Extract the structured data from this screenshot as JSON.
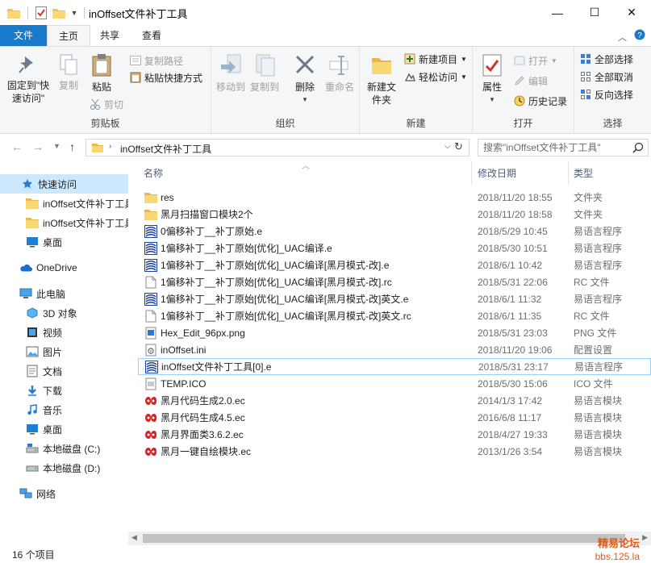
{
  "window": {
    "title": "inOffset文件补丁工具",
    "minimize_glyph": "—",
    "maximize_glyph": "☐",
    "close_glyph": "✕"
  },
  "tabs": {
    "file": "文件",
    "home": "主页",
    "share": "共享",
    "view": "查看"
  },
  "ribbon": {
    "clipboard": {
      "group_label": "剪贴板",
      "pin": "固定到\"快速访问\"",
      "copy": "复制",
      "paste": "粘贴",
      "copy_path": "复制路径",
      "paste_shortcut": "粘贴快捷方式",
      "cut": "剪切"
    },
    "organize": {
      "group_label": "组织",
      "move_to": "移动到",
      "copy_to": "复制到",
      "delete": "删除",
      "rename": "重命名"
    },
    "new": {
      "group_label": "新建",
      "new_folder": "新建文件夹",
      "new_item": "新建项目",
      "easy_access": "轻松访问"
    },
    "open": {
      "group_label": "打开",
      "properties": "属性",
      "open": "打开",
      "edit": "编辑",
      "history": "历史记录"
    },
    "select": {
      "group_label": "选择",
      "select_all": "全部选择",
      "select_none": "全部取消",
      "invert": "反向选择"
    }
  },
  "address": {
    "path": "inOffset文件补丁工具",
    "search_placeholder": "搜索\"inOffset文件补丁工具\""
  },
  "navpane": {
    "quick_access": "快速访问",
    "pinned": [
      "inOffset文件补丁工具",
      "inOffset文件补丁工具"
    ],
    "desktop_pinned": "桌面",
    "onedrive": "OneDrive",
    "this_pc": "此电脑",
    "pc_items": [
      "3D 对象",
      "视频",
      "图片",
      "文档",
      "下载",
      "音乐",
      "桌面",
      "本地磁盘 (C:)",
      "本地磁盘 (D:)"
    ],
    "network": "网络"
  },
  "filelist": {
    "columns": {
      "name": "名称",
      "date": "修改日期",
      "type": "类型"
    },
    "files": [
      {
        "icon": "folder-icon",
        "name": "res",
        "date": "2018/11/20 18:55",
        "type": "文件夹"
      },
      {
        "icon": "folder-icon",
        "name": "黑月扫描窗口模块2个",
        "date": "2018/11/20 18:58",
        "type": "文件夹"
      },
      {
        "icon": "e-file-icon",
        "name": "0偏移补丁__补丁原始.e",
        "date": "2018/5/29 10:45",
        "type": "易语言程序"
      },
      {
        "icon": "e-file-icon",
        "name": "1偏移补丁__补丁原始[优化]_UAC编译.e",
        "date": "2018/5/30 10:51",
        "type": "易语言程序"
      },
      {
        "icon": "e-file-icon",
        "name": "1偏移补丁__补丁原始[优化]_UAC编译[黑月模式-改].e",
        "date": "2018/6/1 10:42",
        "type": "易语言程序"
      },
      {
        "icon": "rc-file-icon",
        "name": "1偏移补丁__补丁原始[优化]_UAC编译[黑月模式-改].rc",
        "date": "2018/5/31 22:06",
        "type": "RC 文件"
      },
      {
        "icon": "e-file-icon",
        "name": "1偏移补丁__补丁原始[优化]_UAC编译[黑月模式-改]英文.e",
        "date": "2018/6/1 11:32",
        "type": "易语言程序"
      },
      {
        "icon": "rc-file-icon",
        "name": "1偏移补丁__补丁原始[优化]_UAC编译[黑月模式-改]英文.rc",
        "date": "2018/6/1 11:35",
        "type": "RC 文件"
      },
      {
        "icon": "png-file-icon",
        "name": "Hex_Edit_96px.png",
        "date": "2018/5/31 23:03",
        "type": "PNG 文件"
      },
      {
        "icon": "ini-file-icon",
        "name": "inOffset.ini",
        "date": "2018/11/20 19:06",
        "type": "配置设置"
      },
      {
        "icon": "e-file-icon",
        "name": "inOffset文件补丁工具[0].e",
        "date": "2018/5/31 23:17",
        "type": "易语言程序"
      },
      {
        "icon": "ico-file-icon",
        "name": "TEMP.ICO",
        "date": "2018/5/30 15:06",
        "type": "ICO 文件"
      },
      {
        "icon": "ec-module-icon",
        "name": "黑月代码生成2.0.ec",
        "date": "2014/1/3 17:42",
        "type": "易语言模块"
      },
      {
        "icon": "ec-module-icon",
        "name": "黑月代码生成4.5.ec",
        "date": "2016/6/8 11:17",
        "type": "易语言模块"
      },
      {
        "icon": "ec-module-icon",
        "name": "黑月界面类3.6.2.ec",
        "date": "2018/4/27 19:33",
        "type": "易语言模块"
      },
      {
        "icon": "ec-module-icon",
        "name": "黑月一键自绘模块.ec",
        "date": "2013/1/26 3:54",
        "type": "易语言模块"
      }
    ]
  },
  "status": {
    "item_count": "16 个项目"
  },
  "watermark": {
    "line1": "精易论坛",
    "line2": "bbs.125.la"
  },
  "colors": {
    "accent": "#1979ca",
    "selection": "#cce8ff",
    "folder": "#f3c35a",
    "watermark": "#e05a1a"
  }
}
